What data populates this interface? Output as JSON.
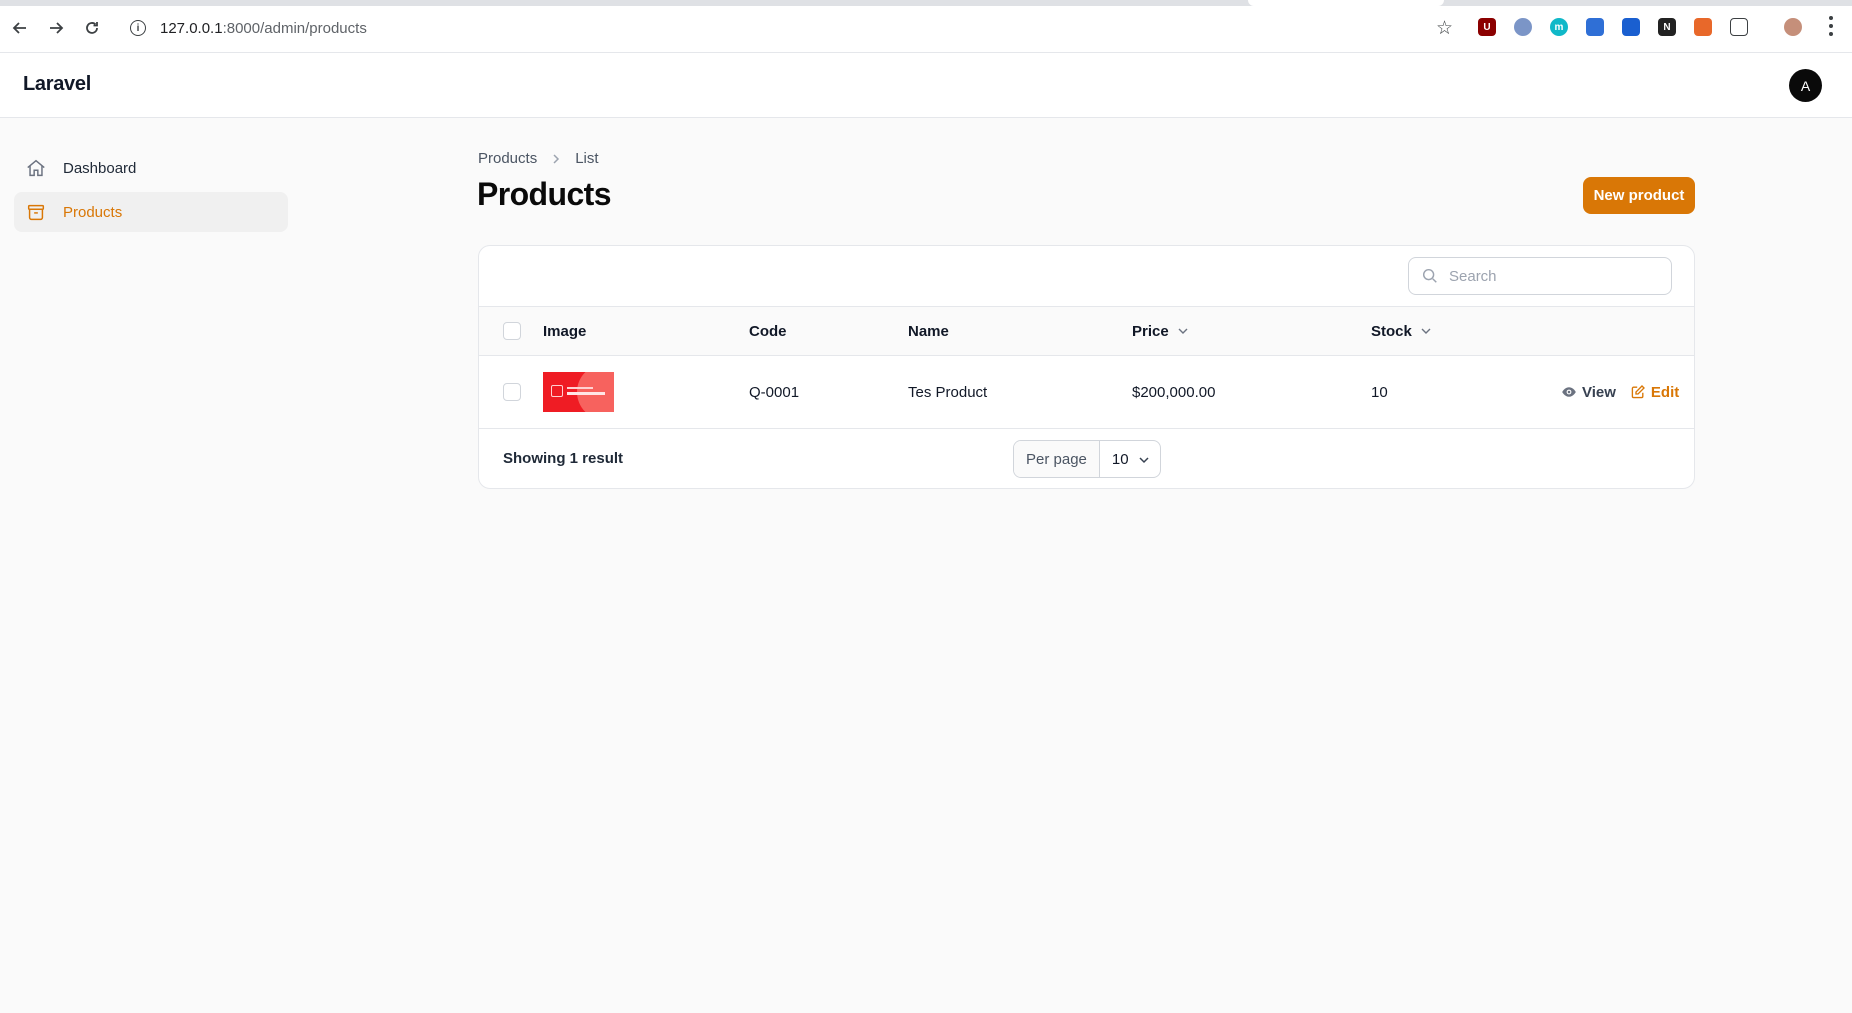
{
  "browser": {
    "url_host": "127.0.0.1",
    "url_path": ":8000/admin/products"
  },
  "app": {
    "brand": "Laravel",
    "avatar_initial": "A"
  },
  "sidebar": {
    "items": [
      {
        "label": "Dashboard",
        "icon": "home-icon",
        "active": false
      },
      {
        "label": "Products",
        "icon": "archive-box-icon",
        "active": true
      }
    ]
  },
  "breadcrumb": {
    "items": [
      "Products",
      "List"
    ]
  },
  "page": {
    "title": "Products",
    "new_button_label": "New product",
    "accent_color": "#d97706"
  },
  "table": {
    "search_placeholder": "Search",
    "columns": [
      "Image",
      "Code",
      "Name",
      "Price",
      "Stock"
    ],
    "sortable_columns": [
      "Price",
      "Stock"
    ],
    "rows": [
      {
        "code": "Q-0001",
        "name": "Tes Product",
        "price": "$200,000.00",
        "stock": "10"
      }
    ],
    "row_actions": {
      "view": "View",
      "edit": "Edit"
    },
    "footer": {
      "showing": "Showing 1 result",
      "per_page_label": "Per page",
      "per_page_value": "10"
    }
  }
}
